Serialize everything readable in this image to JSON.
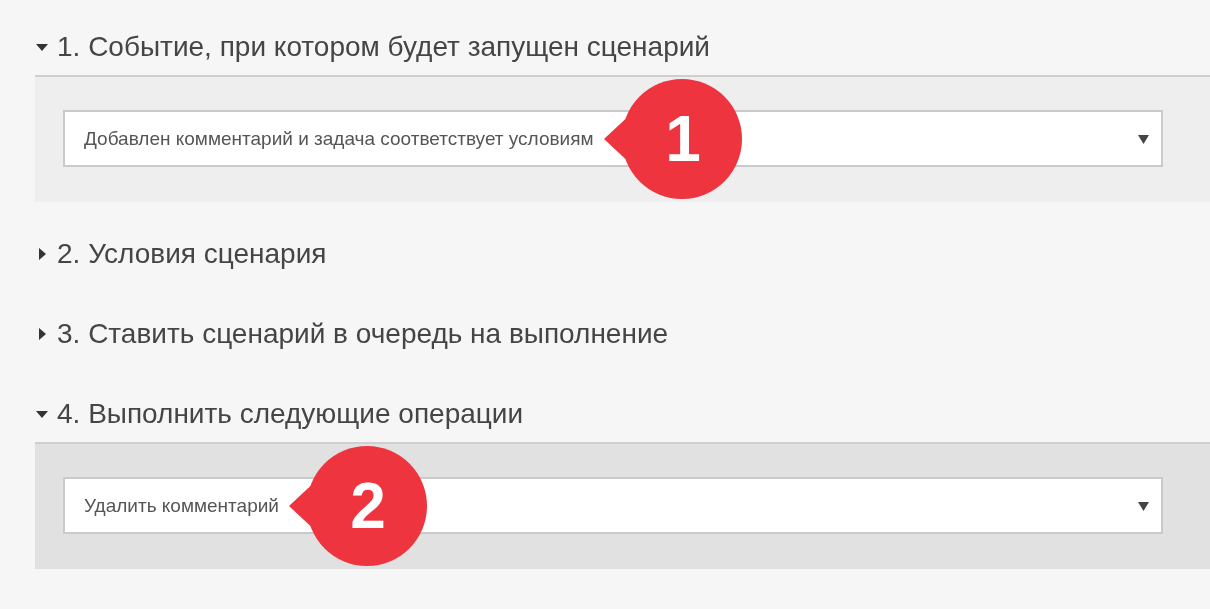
{
  "sections": [
    {
      "title": "1. Событие, при котором будет запущен сценарий",
      "expanded": true,
      "highlighted": false,
      "select": {
        "value": "Добавлен комментарий и задача соответствует условиям"
      },
      "callout": "1"
    },
    {
      "title": "2. Условия сценария",
      "expanded": false
    },
    {
      "title": "3. Ставить сценарий в очередь на выполнение",
      "expanded": false
    },
    {
      "title": "4. Выполнить следующие операции",
      "expanded": true,
      "highlighted": true,
      "select": {
        "value": "Удалить комментарий"
      },
      "callout": "2"
    }
  ]
}
